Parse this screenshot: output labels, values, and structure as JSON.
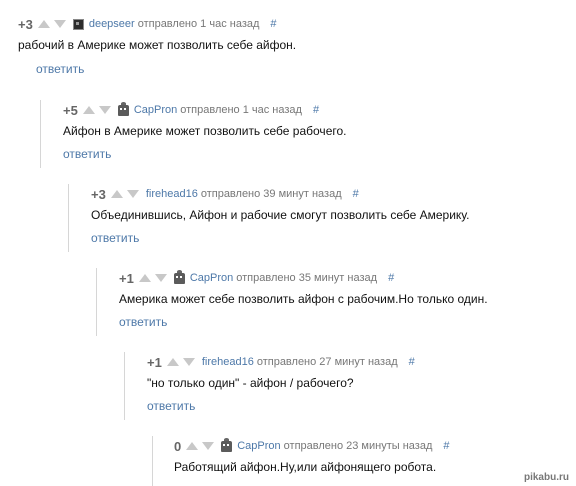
{
  "comments": [
    {
      "score": "+3",
      "author": "deepseer",
      "sent": "отправлено 1 час назад",
      "hash": "#",
      "text": "рабочий в Америке может позволить себе айфон.",
      "reply": "ответить",
      "avatar_icon": "dark-square-avatar"
    },
    {
      "score": "+5",
      "author": "CapPron",
      "sent": "отправлено 1 час назад",
      "hash": "#",
      "text": "Айфон в Америке может позволить себе рабочего.",
      "reply": "ответить",
      "avatar_icon": "robot-avatar"
    },
    {
      "score": "+3",
      "author": "firehead16",
      "sent": "отправлено 39 минут назад",
      "hash": "#",
      "text": "Объединившись, Айфон и рабочие смогут позволить себе Америку.",
      "reply": "ответить"
    },
    {
      "score": "+1",
      "author": "CapPron",
      "sent": "отправлено 35 минут назад",
      "hash": "#",
      "text": "Америка может себе позволить айфон с рабочим.Но только один.",
      "reply": "ответить",
      "avatar_icon": "robot-avatar"
    },
    {
      "score": "+1",
      "author": "firehead16",
      "sent": "отправлено 27 минут назад",
      "hash": "#",
      "text": "\"но только один\" - айфон / рабочего?",
      "reply": "ответить"
    },
    {
      "score": "0",
      "author": "CapPron",
      "sent": "отправлено 23 минуты назад",
      "hash": "#",
      "text": "Работящий айфон.Ну,или айфонящего робота.",
      "avatar_icon": "robot-avatar"
    }
  ],
  "watermark": "pikabu.ru",
  "colors": {
    "link": "#4d78a8",
    "thread_line": "#d6d6d6",
    "vote_arrow": "#c8c8c8"
  }
}
